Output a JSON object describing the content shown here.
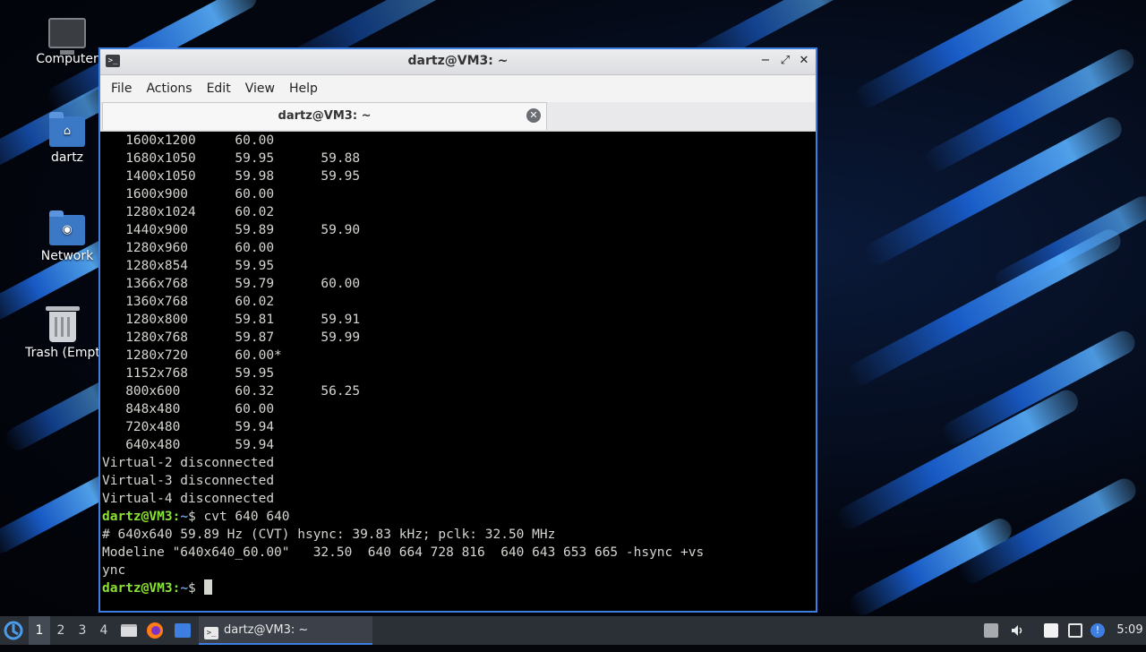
{
  "desktop": {
    "icons": [
      {
        "label": "Computer"
      },
      {
        "label": "dartz"
      },
      {
        "label": "Network"
      },
      {
        "label": "Trash (Empt"
      }
    ]
  },
  "window": {
    "title": "dartz@VM3: ~",
    "controls": {
      "minimize": "−",
      "maximize": "⤢",
      "close": "✕"
    },
    "menu": [
      "File",
      "Actions",
      "Edit",
      "View",
      "Help"
    ],
    "tab": {
      "label": "dartz@VM3: ~",
      "close": "✕"
    }
  },
  "terminal": {
    "modes": [
      {
        "res": "1600x1200",
        "r1": "60.00",
        "r2": ""
      },
      {
        "res": "1680x1050",
        "r1": "59.95",
        "r2": "59.88"
      },
      {
        "res": "1400x1050",
        "r1": "59.98",
        "r2": "59.95"
      },
      {
        "res": "1600x900",
        "r1": "60.00",
        "r2": ""
      },
      {
        "res": "1280x1024",
        "r1": "60.02",
        "r2": ""
      },
      {
        "res": "1440x900",
        "r1": "59.89",
        "r2": "59.90"
      },
      {
        "res": "1280x960",
        "r1": "60.00",
        "r2": ""
      },
      {
        "res": "1280x854",
        "r1": "59.95",
        "r2": ""
      },
      {
        "res": "1366x768",
        "r1": "59.79",
        "r2": "60.00"
      },
      {
        "res": "1360x768",
        "r1": "60.02",
        "r2": ""
      },
      {
        "res": "1280x800",
        "r1": "59.81",
        "r2": "59.91"
      },
      {
        "res": "1280x768",
        "r1": "59.87",
        "r2": "59.99"
      },
      {
        "res": "1280x720",
        "r1": "60.00*",
        "r2": ""
      },
      {
        "res": "1152x768",
        "r1": "59.95",
        "r2": ""
      },
      {
        "res": "800x600",
        "r1": "60.32",
        "r2": "56.25"
      },
      {
        "res": "848x480",
        "r1": "60.00",
        "r2": ""
      },
      {
        "res": "720x480",
        "r1": "59.94",
        "r2": ""
      },
      {
        "res": "640x480",
        "r1": "59.94",
        "r2": ""
      }
    ],
    "disconnected": [
      "Virtual-2 disconnected",
      "Virtual-3 disconnected",
      "Virtual-4 disconnected"
    ],
    "prompt_user": "dartz@VM3",
    "prompt_path": "~",
    "prompt_sym": "$",
    "command": "cvt 640 640",
    "output": [
      "# 640x640 59.89 Hz (CVT) hsync: 39.83 kHz; pclk: 32.50 MHz",
      "Modeline \"640x640_60.00\"   32.50  640 664 728 816  640 643 653 665 -hsync +vs",
      "ync"
    ]
  },
  "taskbar": {
    "workspaces": [
      "1",
      "2",
      "3",
      "4"
    ],
    "active_workspace": "1",
    "task_label": "dartz@VM3: ~",
    "clock": "5:09"
  }
}
